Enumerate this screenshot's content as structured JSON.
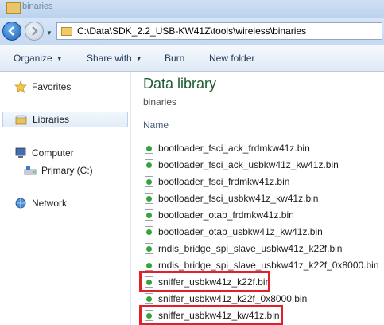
{
  "window": {
    "title": "binaries"
  },
  "address": {
    "path": "C:\\Data\\SDK_2.2_USB-KW41Z\\tools\\wireless\\binaries"
  },
  "toolbar": {
    "organize": "Organize",
    "share_with": "Share with",
    "burn": "Burn",
    "new_folder": "New folder"
  },
  "nav": {
    "favorites": "Favorites",
    "libraries": "Libraries",
    "computer": "Computer",
    "primary_drive": "Primary (C:)",
    "network": "Network"
  },
  "library": {
    "title": "Data library",
    "subtitle": "binaries",
    "column_name": "Name"
  },
  "files": [
    "bootloader_fsci_ack_frdmkw41z.bin",
    "bootloader_fsci_ack_usbkw41z_kw41z.bin",
    "bootloader_fsci_frdmkw41z.bin",
    "bootloader_fsci_usbkw41z_kw41z.bin",
    "bootloader_otap_frdmkw41z.bin",
    "bootloader_otap_usbkw41z_kw41z.bin",
    "rndis_bridge_spi_slave_usbkw41z_k22f.bin",
    "rndis_bridge_spi_slave_usbkw41z_k22f_0x8000.bin",
    "sniffer_usbkw41z_k22f.bin",
    "sniffer_usbkw41z_k22f_0x8000.bin",
    "sniffer_usbkw41z_kw41z.bin"
  ],
  "colors": {
    "highlight": "#e0202c",
    "library_title": "#1e5c34",
    "toolbar_text": "#1e395b"
  }
}
